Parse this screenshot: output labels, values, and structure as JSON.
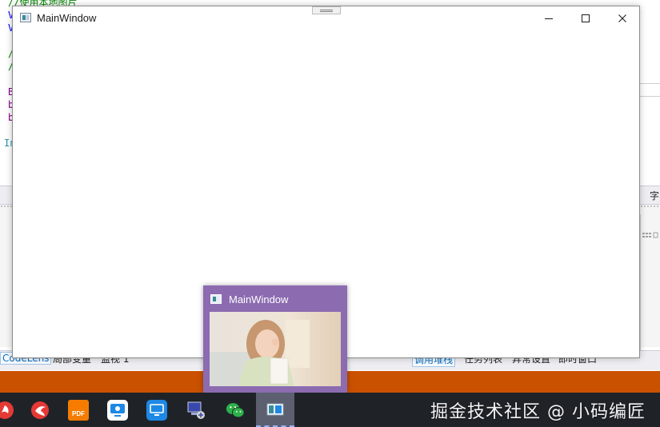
{
  "background_ide": {
    "code_lines": [
      {
        "text": "//使用本地图片",
        "color": "green"
      },
      {
        "text": "V",
        "color": "blue"
      },
      {
        "text": "V",
        "color": "blue"
      },
      {
        "text": "/",
        "color": "green"
      },
      {
        "text": "/",
        "color": "green"
      },
      {
        "text": "B",
        "color": "purple"
      },
      {
        "text": "b",
        "color": "purple"
      },
      {
        "text": "b",
        "color": "purple"
      },
      {
        "text": "In",
        "color": "teal"
      }
    ],
    "panel_header_glyph": "字",
    "status_tabs": {
      "codelens": "CodeLens",
      "locals": "局部变量",
      "watch": "监视 1",
      "call_stack": "调用堆栈",
      "task_list": "任务列表",
      "exception_settings": "异常设置",
      "immediate": "即时窗口"
    },
    "accent_colors": {
      "status_bar": "#ca5100"
    }
  },
  "main_window": {
    "title": "MainWindow",
    "controls": {
      "minimize": "minimize-icon",
      "maximize": "maximize-icon",
      "close": "close-icon"
    }
  },
  "taskbar": {
    "items": [
      {
        "icon": "app-red-partial-icon",
        "color": "#e53935"
      },
      {
        "icon": "app-red-bird-icon",
        "color": "#e53935"
      },
      {
        "icon": "pdf-reader-icon",
        "color": "#f57c00",
        "label": "PDF"
      },
      {
        "icon": "remote-desktop-icon",
        "color": "#1e88e5"
      },
      {
        "icon": "screen-share-icon",
        "color": "#1e88e5"
      },
      {
        "icon": "network-computer-icon",
        "color": "#3949ab"
      },
      {
        "icon": "wechat-icon",
        "color": "#2db04a"
      },
      {
        "icon": "mainwindow-app-icon",
        "color": "#3a8a9a",
        "active": true
      }
    ],
    "watermark": "掘金技术社区 @ 小码编匠"
  },
  "thumbnail_preview": {
    "title": "MainWindow",
    "accent": "#8c6bb1"
  }
}
